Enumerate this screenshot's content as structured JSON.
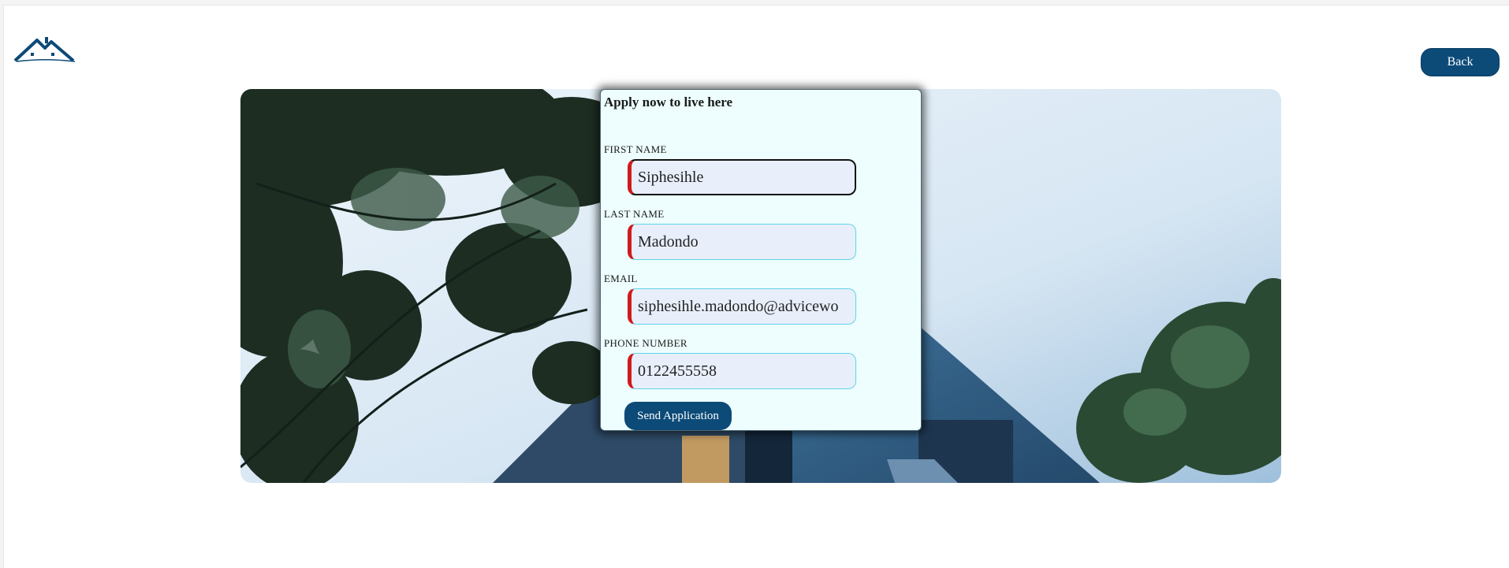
{
  "header": {
    "logo_icon": "house-roof-logo-icon",
    "back_label": "Back"
  },
  "colors": {
    "brand": "#0c4a78",
    "card_bg": "#eefefe",
    "input_bg": "#e8effb",
    "input_border": "#5fd3e6",
    "required_marker": "#d11a1a"
  },
  "form": {
    "title": "Apply now to live here",
    "fields": [
      {
        "label": "FIRST NAME",
        "value": "Siphesihle"
      },
      {
        "label": "LAST NAME",
        "value": "Madondo"
      },
      {
        "label": "EMAIL",
        "value": "siphesihle.madondo@advicewo"
      },
      {
        "label": "PHONE NUMBER",
        "value": "0122455558"
      }
    ],
    "submit_label": "Send Application"
  }
}
